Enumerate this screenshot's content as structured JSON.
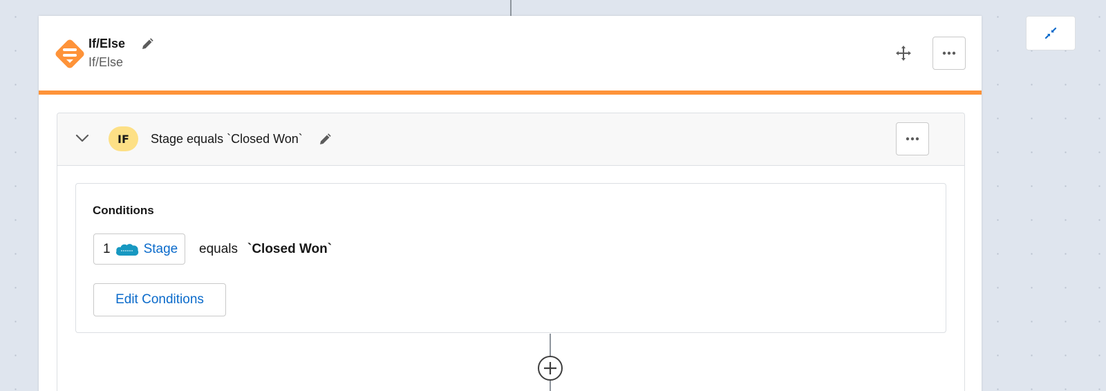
{
  "step": {
    "title": "If/Else",
    "subtitle": "If/Else",
    "accent_color": "#fe9339"
  },
  "branch": {
    "badge": "IF",
    "badge_color": "#fde086",
    "title": "Stage equals `Closed Won`"
  },
  "conditions": {
    "heading": "Conditions",
    "items": [
      {
        "number": "1",
        "app_icon": "salesforce-cloud-icon",
        "field": "Stage",
        "operator": "equals",
        "value": "`Closed Won`"
      }
    ],
    "edit_label": "Edit Conditions"
  },
  "icons": {
    "step_icon": "if-else-diamond-icon",
    "edit": "pencil-icon",
    "move": "move-arrows-icon",
    "more": "ellipsis-icon",
    "collapse": "collapse-arrows-icon",
    "chevron": "chevron-down-icon",
    "add": "plus-circle-icon"
  },
  "link_color": "#0b6bcb"
}
